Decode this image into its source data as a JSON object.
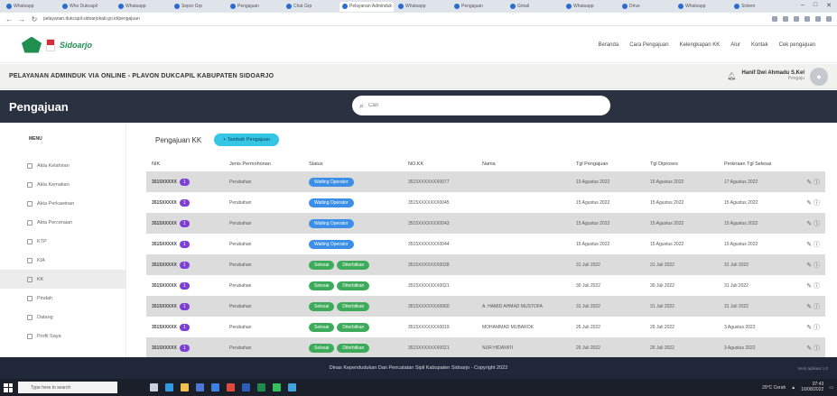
{
  "browser": {
    "tabs": [
      "Whatsapp",
      "Who Dukcapil",
      "Whatsapp",
      "Sepor Grp",
      "Pengajuan",
      "Chat Grp",
      "Pelayanan Adminduk",
      "Whatsapp",
      "Pengajuan",
      "Gmail",
      "Whatsapp",
      "Drive",
      "Whatsapp",
      "Sistem"
    ],
    "active_tab_index": 6,
    "url": "pelayanan.dukcapil.sidoarjokab.go.id/pengajuan"
  },
  "header": {
    "logo_text": "Sidoarjo",
    "nav": [
      "Beranda",
      "Cara Pengajuan",
      "Kelengkapan KK",
      "Alur",
      "Kontak",
      "Cek pengajuan"
    ]
  },
  "title_strip": {
    "title": "PELAYANAN ADMINDUK VIA ONLINE - PLAVON DUKCAPIL KABUPATEN SIDOARJO",
    "user_name": "Hanif Dwi Ahmadu S.Kel",
    "user_role": "Pengaju"
  },
  "darkbar": {
    "heading": "Pengajuan",
    "search_placeholder": "Cari"
  },
  "sidebar": {
    "title": "MENU",
    "items": [
      {
        "label": "Akta Kelahiran",
        "active": false
      },
      {
        "label": "Akta Kematian",
        "active": false
      },
      {
        "label": "Akta Perkawinan",
        "active": false
      },
      {
        "label": "Akta Perceraian",
        "active": false
      },
      {
        "label": "KTP",
        "active": false
      },
      {
        "label": "KIA",
        "active": false
      },
      {
        "label": "KK",
        "active": true
      },
      {
        "label": "Pindah",
        "active": false
      },
      {
        "label": "Datang",
        "active": false
      },
      {
        "label": "Profil Saya",
        "active": false
      }
    ]
  },
  "main": {
    "section_label": "Pengajuan KK",
    "add_button": "+ Tambah Pengajuan",
    "columns": [
      "NIK",
      "Jenis Permohonan",
      "Status",
      "NO.KK",
      "Nama",
      "Tgl Pengajuan",
      "Tgl Diproses",
      "Perkiraan Tgl Selesai",
      ""
    ],
    "rows": [
      {
        "nik": "3515XXXXX",
        "count": "1",
        "jenis": "Perubahan",
        "status": [
          "Waiting Operator"
        ],
        "nokk": "3515XXXXXXX0077",
        "nama": "",
        "tgl_pengajuan": "15 Agustus 2022",
        "tgl_diproses": "15 Agustus 2022",
        "tgl_selesai": "17 Agustus 2022"
      },
      {
        "nik": "3515XXXXX",
        "count": "1",
        "jenis": "Perubahan",
        "status": [
          "Waiting Operator"
        ],
        "nokk": "3515XXXXXXX0045",
        "nama": "",
        "tgl_pengajuan": "15 Agustus 2022",
        "tgl_diproses": "15 Agustus 2022",
        "tgl_selesai": "15 Agustus 2022"
      },
      {
        "nik": "3515XXXXX",
        "count": "1",
        "jenis": "Perubahan",
        "status": [
          "Waiting Operator"
        ],
        "nokk": "3515XXXXXXX0043",
        "nama": "",
        "tgl_pengajuan": "15 Agustus 2022",
        "tgl_diproses": "15 Agustus 2022",
        "tgl_selesai": "15 Agustus 2022"
      },
      {
        "nik": "3515XXXXX",
        "count": "1",
        "jenis": "Perubahan",
        "status": [
          "Waiting Operator"
        ],
        "nokk": "3515XXXXXXX0044",
        "nama": "",
        "tgl_pengajuan": "15 Agustus 2022",
        "tgl_diproses": "15 Agustus 2022",
        "tgl_selesai": "15 Agustus 2022"
      },
      {
        "nik": "3515XXXXX",
        "count": "1",
        "jenis": "Perubahan",
        "status": [
          "Selesai",
          "Diterbitkan"
        ],
        "nokk": "3515XXXXXXX0028",
        "nama": "",
        "tgl_pengajuan": "31 Juli 2022",
        "tgl_diproses": "31 Juli 2022",
        "tgl_selesai": "31 Juli 2022"
      },
      {
        "nik": "3515XXXXX",
        "count": "1",
        "jenis": "Perubahan",
        "status": [
          "Selesai",
          "Diterbitkan"
        ],
        "nokk": "3515XXXXXXX0021",
        "nama": "",
        "tgl_pengajuan": "30 Juli 2022",
        "tgl_diproses": "30 Juli 2022",
        "tgl_selesai": "31 Juli 2022"
      },
      {
        "nik": "3515XXXXX",
        "count": "1",
        "jenis": "Perubahan",
        "status": [
          "Selesai",
          "Diterbitkan"
        ],
        "nokk": "3515XXXXXXX0060",
        "nama": "A. HAMID AHMAD MUSTOFA",
        "tgl_pengajuan": "31 Juli 2022",
        "tgl_diproses": "31 Juli 2022",
        "tgl_selesai": "31 Juli 2022"
      },
      {
        "nik": "3515XXXXX",
        "count": "1",
        "jenis": "Perubahan",
        "status": [
          "Selesai",
          "Diterbitkan"
        ],
        "nokk": "3515XXXXXXX0019",
        "nama": "MOHAMMAD MUBAROK",
        "tgl_pengajuan": "26 Juli 2022",
        "tgl_diproses": "26 Juli 2022",
        "tgl_selesai": "3 Agustus 2022"
      },
      {
        "nik": "3515XXXXX",
        "count": "1",
        "jenis": "Perubahan",
        "status": [
          "Selesai",
          "Diterbitkan"
        ],
        "nokk": "3515XXXXXXX0021",
        "nama": "NUR HIDAYATI",
        "tgl_pengajuan": "26 Juli 2022",
        "tgl_diproses": "26 Juli 2022",
        "tgl_selesai": "3 Agustus 2022"
      }
    ]
  },
  "footer": {
    "text": "Dinas Kependudukan Dan Pencatatan Sipil Kabupaten Sidoarjo - Copyright 2022",
    "version": "Versi aplikasi 1.0"
  },
  "taskbar": {
    "search_placeholder": "Type here to search",
    "weather": "29°C Cerah",
    "time": "07:43",
    "date": "16/08/2022"
  },
  "colors": {
    "accent_cyan": "#35c6e6",
    "status_blue": "#3b8fe8",
    "status_green": "#3dab5a",
    "count_purple": "#7d3fd6",
    "dark_bar": "#2a3140"
  }
}
